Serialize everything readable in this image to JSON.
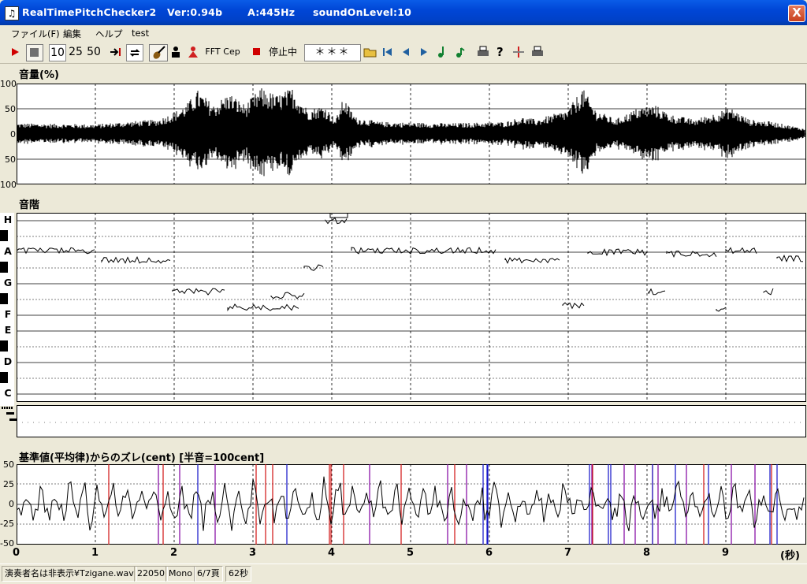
{
  "window": {
    "title": "RealTimePitchChecker2   Ver:0.94b       A:445Hz     soundOnLevel:10",
    "close_label": "X",
    "icon_name": "treble-clef-icon"
  },
  "menu": [
    "ファイル(F)",
    "編集",
    "ヘルプ",
    "test"
  ],
  "toolbar": {
    "speed_labels": [
      "10",
      "25",
      "50"
    ],
    "fft_label": "FFT",
    "cep_label": "Cep",
    "stop_status": "停止中",
    "note_display": "＊＊＊",
    "icons": [
      "play-icon",
      "stop-icon",
      "skip-end-icon",
      "loop-icon",
      "violin-icon",
      "person-black-icon",
      "person-red-icon",
      "record-icon",
      "open-folder-icon",
      "first-frame-icon",
      "prev-frame-icon",
      "next-frame-icon",
      "note-green-icon",
      "note-green-small-icon",
      "print-icon",
      "help-icon",
      "marker-icon",
      "print2-icon"
    ]
  },
  "volume": {
    "title": "音量(%)",
    "ticks": [
      "100",
      "50",
      "0",
      "50",
      "100"
    ]
  },
  "scale": {
    "title": "音階",
    "notes": [
      "H",
      "A",
      "G",
      "F",
      "E",
      "D",
      "C"
    ]
  },
  "deviation": {
    "title": "基準値(平均律)からのズレ(cent) [半音=100cent]",
    "ticks": [
      "50",
      "25",
      "0",
      "-25",
      "-50"
    ]
  },
  "x_axis": {
    "ticks": [
      "0",
      "1",
      "2",
      "3",
      "4",
      "5",
      "6",
      "7",
      "8",
      "9"
    ],
    "unit": "(秒)"
  },
  "status": [
    "演奏者名は非表示¥Tzigane.wav",
    "22050",
    "Mono",
    "6/7頁",
    "62秒"
  ],
  "colors": {
    "titlebar": "#0046d6",
    "record_red": "#d00000",
    "line_red": "#d01010",
    "line_blue": "#1010c8",
    "line_purple": "#8000a0"
  }
}
